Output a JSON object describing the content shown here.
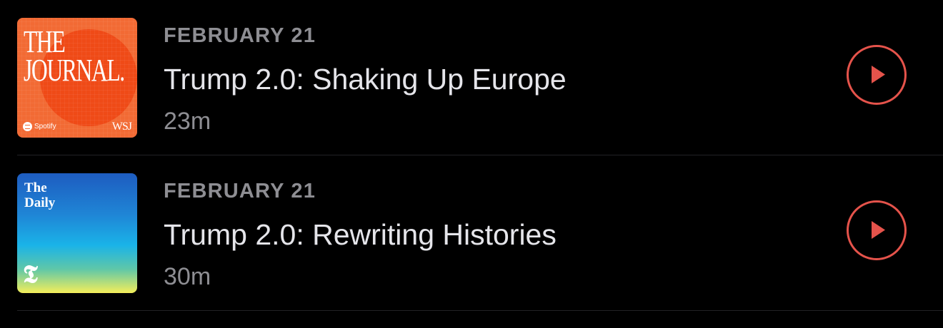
{
  "episodes": [
    {
      "date": "FEBRUARY 21",
      "title": "Trump 2.0: Shaking Up Europe",
      "duration": "23m",
      "artwork": {
        "podcast": "THE\nJOURNAL.",
        "spotify_label": "Spotify",
        "publisher": "WSJ",
        "background": "#f26a34",
        "accent": "#ef4a17"
      },
      "play_icon": "play-icon"
    },
    {
      "date": "FEBRUARY 21",
      "title": "Trump 2.0: Rewriting Histories",
      "duration": "30m",
      "artwork": {
        "podcast": "The\nDaily",
        "publisher_logo": "𝕿"
      },
      "play_icon": "play-icon"
    }
  ],
  "colors": {
    "background": "#000000",
    "date_text": "#8e8e93",
    "title_text": "#e5e5ea",
    "play_accent": "#e5534b",
    "divider": "#222225"
  }
}
